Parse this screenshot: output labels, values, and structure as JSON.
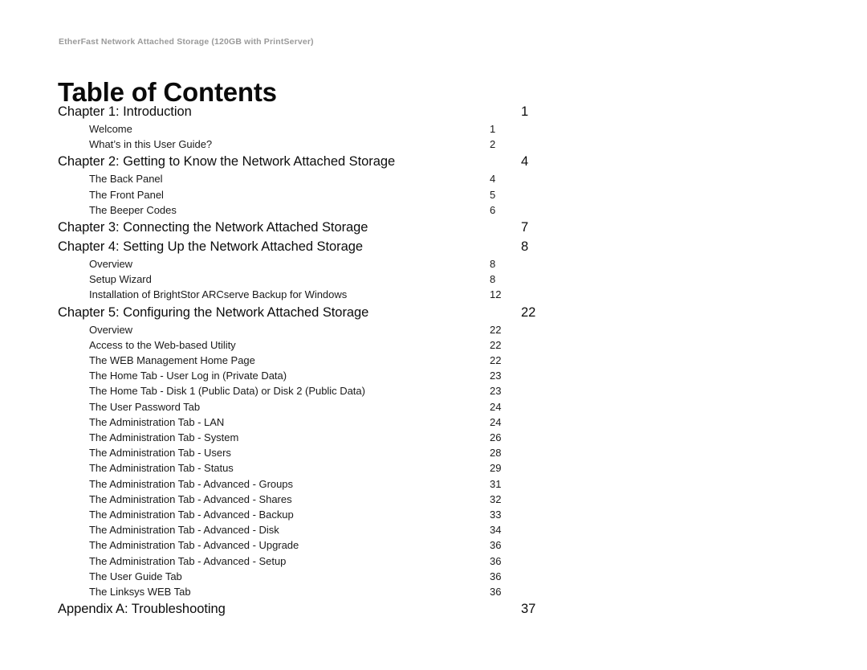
{
  "document": {
    "running_header": "EtherFast Network Attached Storage (120GB with PrintServer)",
    "title": "Table of Contents"
  },
  "toc": {
    "entries": [
      {
        "level": "chapter",
        "label": "Chapter 1: Introduction",
        "page": "1"
      },
      {
        "level": "section",
        "label": "Welcome",
        "page": "1"
      },
      {
        "level": "section",
        "label": "What’s in this User Guide?",
        "page": "2"
      },
      {
        "level": "chapter",
        "label": "Chapter 2: Getting to Know the Network Attached Storage",
        "page": "4"
      },
      {
        "level": "section",
        "label": "The Back Panel",
        "page": "4"
      },
      {
        "level": "section",
        "label": "The Front Panel",
        "page": "5"
      },
      {
        "level": "section",
        "label": "The Beeper Codes",
        "page": "6"
      },
      {
        "level": "chapter",
        "label": "Chapter 3: Connecting the Network Attached Storage",
        "page": "7"
      },
      {
        "level": "chapter",
        "label": "Chapter 4: Setting Up the Network Attached Storage",
        "page": "8"
      },
      {
        "level": "section",
        "label": "Overview",
        "page": "8"
      },
      {
        "level": "section",
        "label": "Setup Wizard",
        "page": "8"
      },
      {
        "level": "section",
        "label": "Installation of BrightStor ARCserve Backup for Windows",
        "page": "12"
      },
      {
        "level": "chapter",
        "label": "Chapter 5: Configuring the Network Attached Storage",
        "page": "22"
      },
      {
        "level": "section",
        "label": "Overview",
        "page": "22"
      },
      {
        "level": "section",
        "label": "Access to the Web-based Utility",
        "page": "22"
      },
      {
        "level": "section",
        "label": "The WEB Management Home Page",
        "page": "22"
      },
      {
        "level": "section",
        "label": "The Home Tab - User Log in (Private Data)",
        "page": "23"
      },
      {
        "level": "section",
        "label": "The Home Tab - Disk 1 (Public Data) or Disk 2 (Public Data)",
        "page": "23"
      },
      {
        "level": "section",
        "label": "The User Password Tab",
        "page": "24"
      },
      {
        "level": "section",
        "label": "The Administration Tab - LAN",
        "page": "24"
      },
      {
        "level": "section",
        "label": "The Administration Tab - System",
        "page": "26"
      },
      {
        "level": "section",
        "label": "The Administration Tab - Users",
        "page": "28"
      },
      {
        "level": "section",
        "label": "The Administration Tab - Status",
        "page": "29"
      },
      {
        "level": "section",
        "label": "The Administration Tab - Advanced - Groups",
        "page": "31"
      },
      {
        "level": "section",
        "label": "The Administration Tab - Advanced - Shares",
        "page": "32"
      },
      {
        "level": "section",
        "label": "The Administration Tab - Advanced - Backup",
        "page": "33"
      },
      {
        "level": "section",
        "label": "The Administration Tab - Advanced - Disk",
        "page": "34"
      },
      {
        "level": "section",
        "label": "The Administration Tab - Advanced - Upgrade",
        "page": "36"
      },
      {
        "level": "section",
        "label": "The Administration Tab - Advanced - Setup",
        "page": "36"
      },
      {
        "level": "section",
        "label": "The User Guide Tab",
        "page": "36"
      },
      {
        "level": "section",
        "label": "The Linksys WEB Tab",
        "page": "36"
      },
      {
        "level": "chapter",
        "label": "Appendix A: Troubleshooting",
        "page": "37"
      }
    ]
  }
}
